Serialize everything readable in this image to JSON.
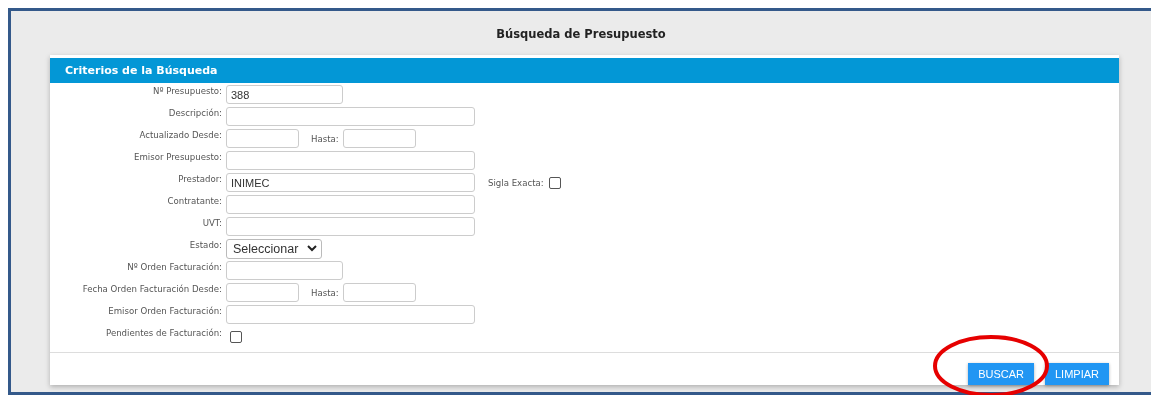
{
  "page_title": "Búsqueda de Presupuesto",
  "panel": {
    "title": "Criterios de la Búsqueda",
    "fields": [
      {
        "label": "Nº Presupuesto:",
        "kind": "short-text",
        "value": "388"
      },
      {
        "label": "Descripción:",
        "kind": "text"
      },
      {
        "label": "Actualizado Desde:",
        "kind": "date-range",
        "to_label": "Hasta:"
      },
      {
        "label": "Emisor Presupuesto:",
        "kind": "text"
      },
      {
        "label": "Prestador:",
        "kind": "text",
        "value": "INIMEC",
        "extra": {
          "label": "Sigla Exacta:",
          "checked": false
        }
      },
      {
        "label": "Contratante:",
        "kind": "text"
      },
      {
        "label": "UVT:",
        "kind": "text"
      },
      {
        "label": "Estado:",
        "kind": "select",
        "value": "Seleccionar"
      },
      {
        "label": "Nº Orden Facturación:",
        "kind": "short-text"
      },
      {
        "label": "Fecha Orden Facturación Desde:",
        "kind": "date-range",
        "to_label": "Hasta:"
      },
      {
        "label": "Emisor Orden Facturación:",
        "kind": "text"
      },
      {
        "label": "Pendientes de Facturación:",
        "kind": "checkbox",
        "checked": false
      }
    ],
    "buttons": [
      "BUSCAR",
      "LIMPIAR"
    ]
  },
  "annotation": {
    "kind": "ellipse",
    "color": "#e60000"
  }
}
